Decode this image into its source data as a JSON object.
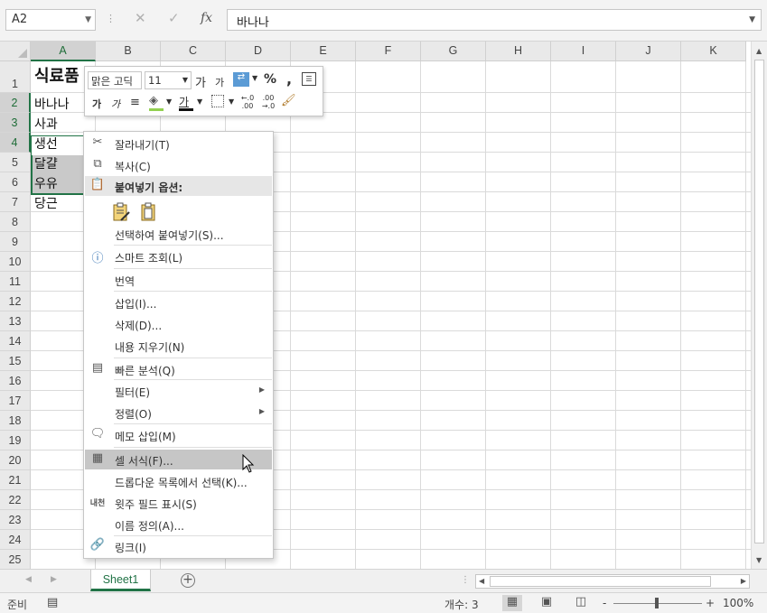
{
  "formula_bar": {
    "name_box": "A2",
    "cancel_icon": "✕",
    "enter_icon": "✓",
    "fx_label": "fx",
    "value": "바나나"
  },
  "columns": [
    "A",
    "B",
    "C",
    "D",
    "E",
    "F",
    "G",
    "H",
    "I",
    "J",
    "K"
  ],
  "rows": [
    "1",
    "2",
    "3",
    "4",
    "5",
    "6",
    "7",
    "8",
    "9",
    "10",
    "11",
    "12",
    "13",
    "14",
    "15",
    "16",
    "17",
    "18",
    "19",
    "20",
    "21",
    "22",
    "23",
    "24",
    "25"
  ],
  "cells": {
    "a1": "식료품",
    "a2": "바나나",
    "a3": "사과",
    "a4": "생선",
    "a5": "달걀",
    "a6": "우유",
    "a7": "당근"
  },
  "mini_toolbar": {
    "font_name": "맑은 고딕",
    "font_size": "11",
    "increase_font": "가",
    "decrease_font": "가",
    "percent": "%",
    "comma": ",",
    "bold": "가",
    "italic": "가",
    "font_color_letter": "가",
    "inc_decimal": "←.0 .00",
    "dec_decimal": ".00 →.0"
  },
  "context_menu": {
    "items": [
      {
        "label": "잘라내기(T)",
        "icon": "scissors-icon"
      },
      {
        "label": "복사(C)",
        "icon": "copy-icon"
      },
      {
        "label": "붙여넣기 옵션:",
        "icon": "paste-options-icon"
      },
      {
        "label": "선택하여 붙여넣기(S)...",
        "icon": ""
      },
      {
        "label": "스마트 조회(L)",
        "icon": "smart-lookup-icon"
      },
      {
        "label": "번역",
        "icon": ""
      },
      {
        "label": "삽입(I)...",
        "icon": ""
      },
      {
        "label": "삭제(D)...",
        "icon": ""
      },
      {
        "label": "내용 지우기(N)",
        "icon": ""
      },
      {
        "label": "빠른 분석(Q)",
        "icon": "quick-analysis-icon"
      },
      {
        "label": "필터(E)",
        "icon": ""
      },
      {
        "label": "정렬(O)",
        "icon": ""
      },
      {
        "label": "메모 삽입(M)",
        "icon": "comment-icon"
      },
      {
        "label": "셀 서식(F)...",
        "icon": "format-cells-icon"
      },
      {
        "label": "드롭다운 목록에서 선택(K)...",
        "icon": ""
      },
      {
        "label": "윗주 필드 표시(S)",
        "icon": "phonetic-icon"
      },
      {
        "label": "이름 정의(A)...",
        "icon": ""
      },
      {
        "label": "링크(I)",
        "icon": "link-icon"
      }
    ],
    "phonetic_glyph": "내천"
  },
  "sheet_tab": "Sheet1",
  "status_bar": {
    "ready": "준비",
    "count": "개수: 3",
    "zoom": "100%",
    "zoom_minus": "-",
    "zoom_plus": "+"
  },
  "colors": {
    "accent": "#217346",
    "selection_fill": "#c9c9c9"
  }
}
